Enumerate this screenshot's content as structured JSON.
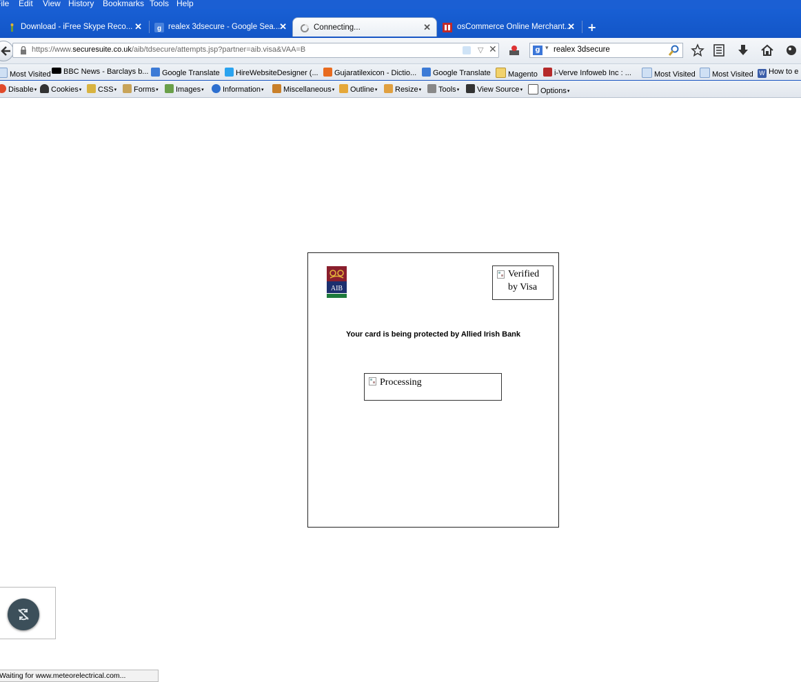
{
  "menu": [
    "File",
    "Edit",
    "View",
    "History",
    "Bookmarks",
    "Tools",
    "Help"
  ],
  "tabs": [
    {
      "label": "Download - iFree Skype Reco...",
      "active": false
    },
    {
      "label": "realex 3dsecure - Google Sea...",
      "active": false
    },
    {
      "label": "Connecting...",
      "active": true
    },
    {
      "label": "osCommerce Online Merchant...",
      "active": false
    }
  ],
  "urlbar": {
    "prefix": "https://www.",
    "domain": "securesuite.co.uk",
    "path": "/aib/tdsecure/attempts.jsp?partner=aib.visa&VAA=B"
  },
  "search": {
    "engine": "g",
    "value": "realex 3dsecure"
  },
  "bookmarks": [
    "Most Visited",
    "BBC News - Barclays b...",
    "Google Translate",
    "HireWebsiteDesigner (...",
    "Gujaratilexicon - Dictio...",
    "Google Translate",
    "Magento",
    "i-Verve Infoweb Inc : ...",
    "Most Visited",
    "Most Visited",
    "How to e"
  ],
  "devtools": [
    "Disable",
    "Cookies",
    "CSS",
    "Forms",
    "Images",
    "Information",
    "Miscellaneous",
    "Outline",
    "Resize",
    "Tools",
    "View Source",
    "Options"
  ],
  "content": {
    "bank_logo_text": "AIB",
    "vbv_line1": "Verified",
    "vbv_line2": "by Visa",
    "protect_message": "Your card is being protected by Allied Irish Bank",
    "processing_text": "Processing"
  },
  "status": "Waiting for www.meteorelectrical.com...",
  "colors": {
    "titlebar": "#1b5fd3",
    "aib_maroon": "#8a1f2d",
    "aib_green": "#1e7a3c"
  }
}
